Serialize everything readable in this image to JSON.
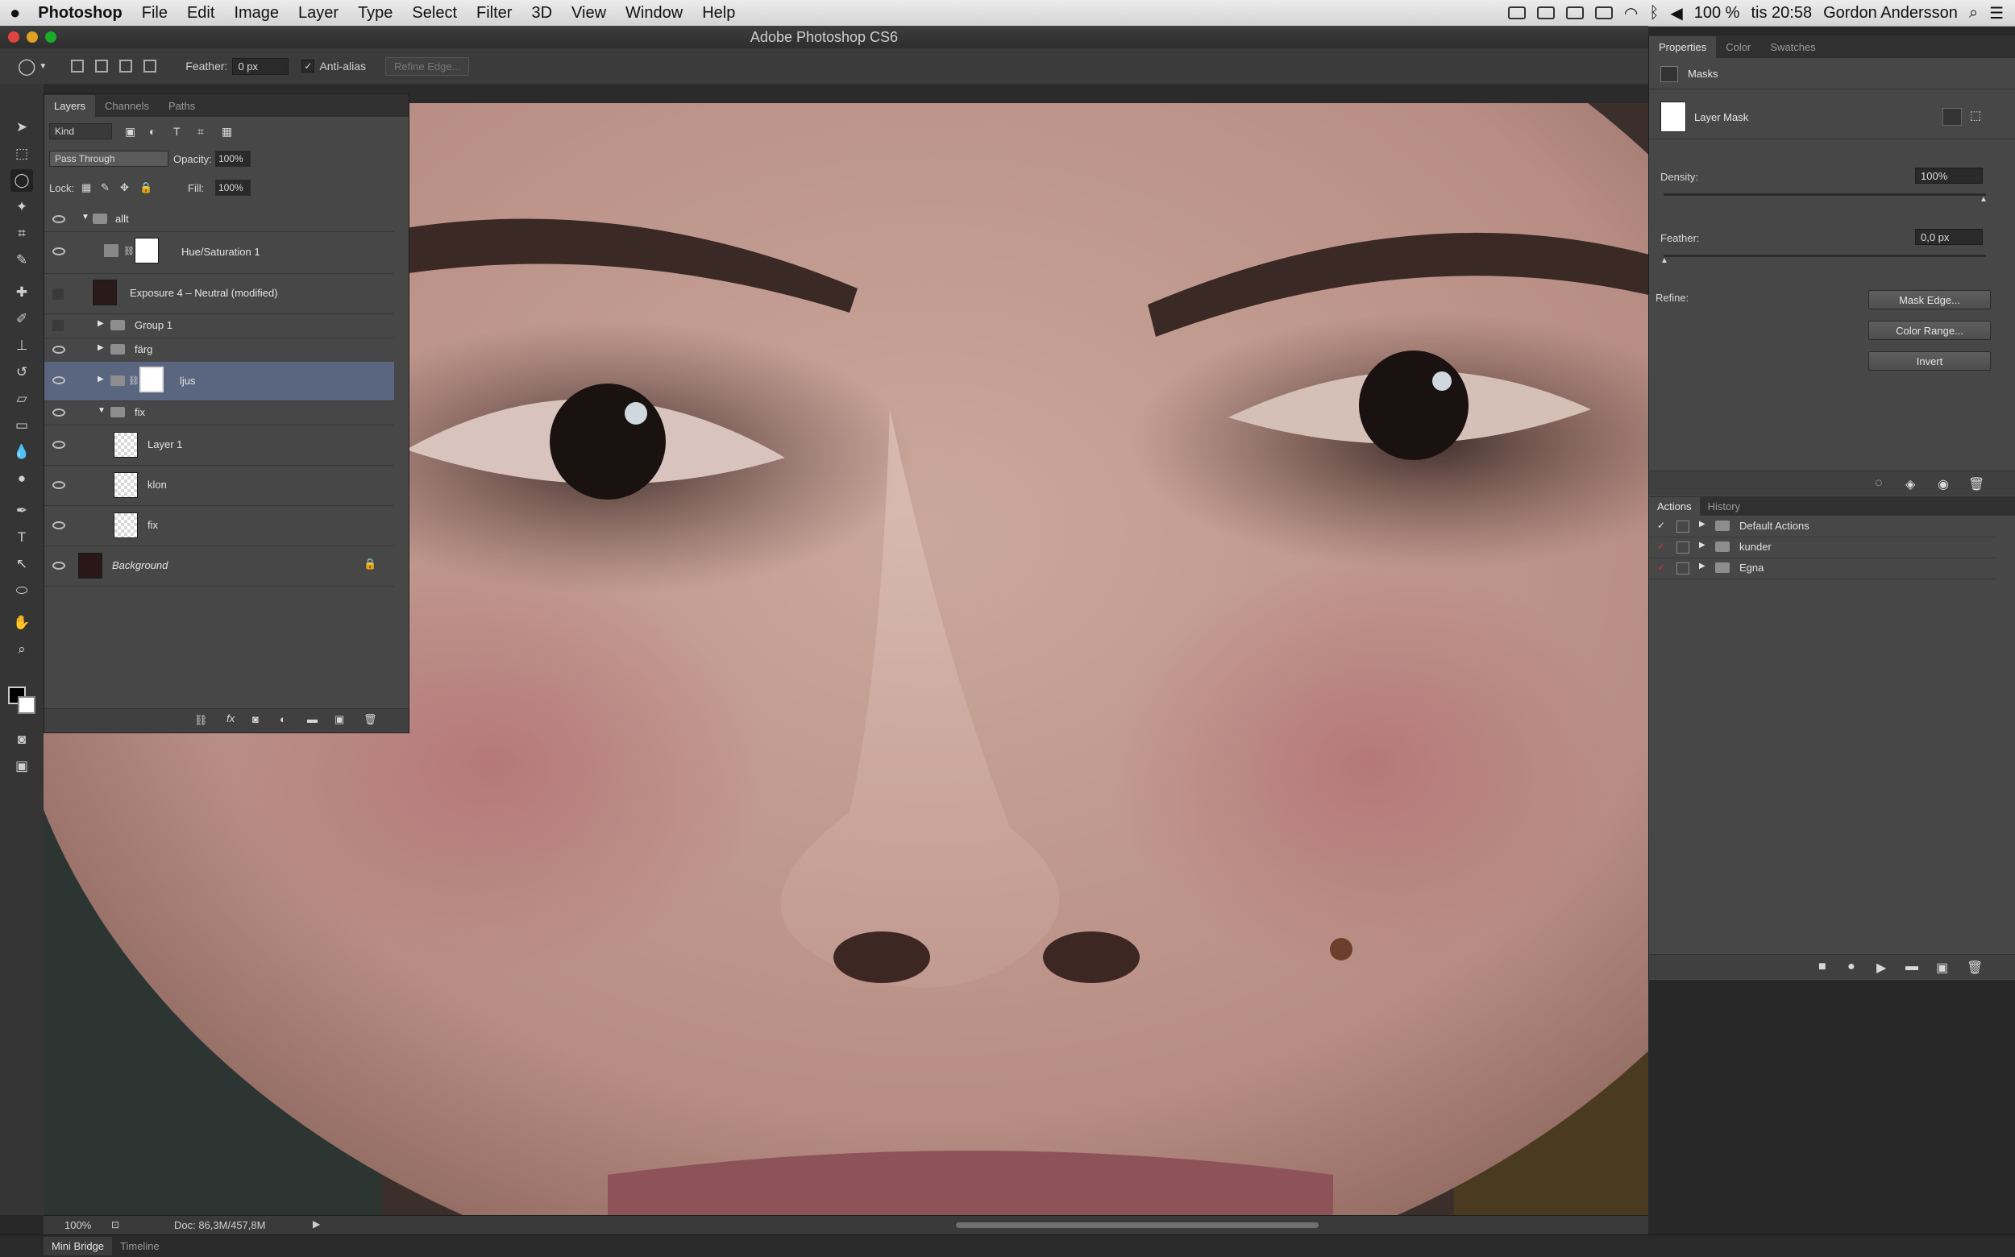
{
  "menubar": {
    "apple": "",
    "app": "Photoshop",
    "items": [
      "File",
      "Edit",
      "Image",
      "Layer",
      "Type",
      "Select",
      "Filter",
      "3D",
      "View",
      "Window",
      "Help"
    ],
    "battery": "100 %",
    "clock": "tis 20:58",
    "user": "Gordon Andersson"
  },
  "window": {
    "title": "Adobe Photoshop CS6"
  },
  "options": {
    "feather_label": "Feather:",
    "feather_value": "0 px",
    "antialias_label": "Anti-alias",
    "refine_edge": "Refine Edge..."
  },
  "layers_panel": {
    "tabs": [
      "Layers",
      "Channels",
      "Paths"
    ],
    "filter_kind": "Kind",
    "blend_mode": "Pass Through",
    "opacity_label": "Opacity:",
    "opacity_value": "100%",
    "lock_label": "Lock:",
    "fill_label": "Fill:",
    "fill_value": "100%",
    "layers": [
      {
        "name": "allt"
      },
      {
        "name": "Hue/Saturation 1"
      },
      {
        "name": "Exposure 4 – Neutral (modified)"
      },
      {
        "name": "Group 1"
      },
      {
        "name": "färg"
      },
      {
        "name": "ljus"
      },
      {
        "name": "fix"
      },
      {
        "name": "Layer 1"
      },
      {
        "name": "klon"
      },
      {
        "name": "fix"
      },
      {
        "name": "Background"
      }
    ]
  },
  "properties_panel": {
    "tabs": [
      "Properties",
      "Color",
      "Swatches"
    ],
    "section": "Masks",
    "mask_type": "Layer Mask",
    "density_label": "Density:",
    "density_value": "100%",
    "feather_label": "Feather:",
    "feather_value": "0,0 px",
    "refine_label": "Refine:",
    "buttons": [
      "Mask Edge...",
      "Color Range...",
      "Invert"
    ]
  },
  "actions_panel": {
    "tabs": [
      "Actions",
      "History"
    ],
    "sets": [
      "Default Actions",
      "kunder",
      "Egna"
    ]
  },
  "status": {
    "zoom": "100%",
    "doc": "Doc: 86,3M/457,8M"
  },
  "bottom_tabs": [
    "Mini Bridge",
    "Timeline"
  ]
}
